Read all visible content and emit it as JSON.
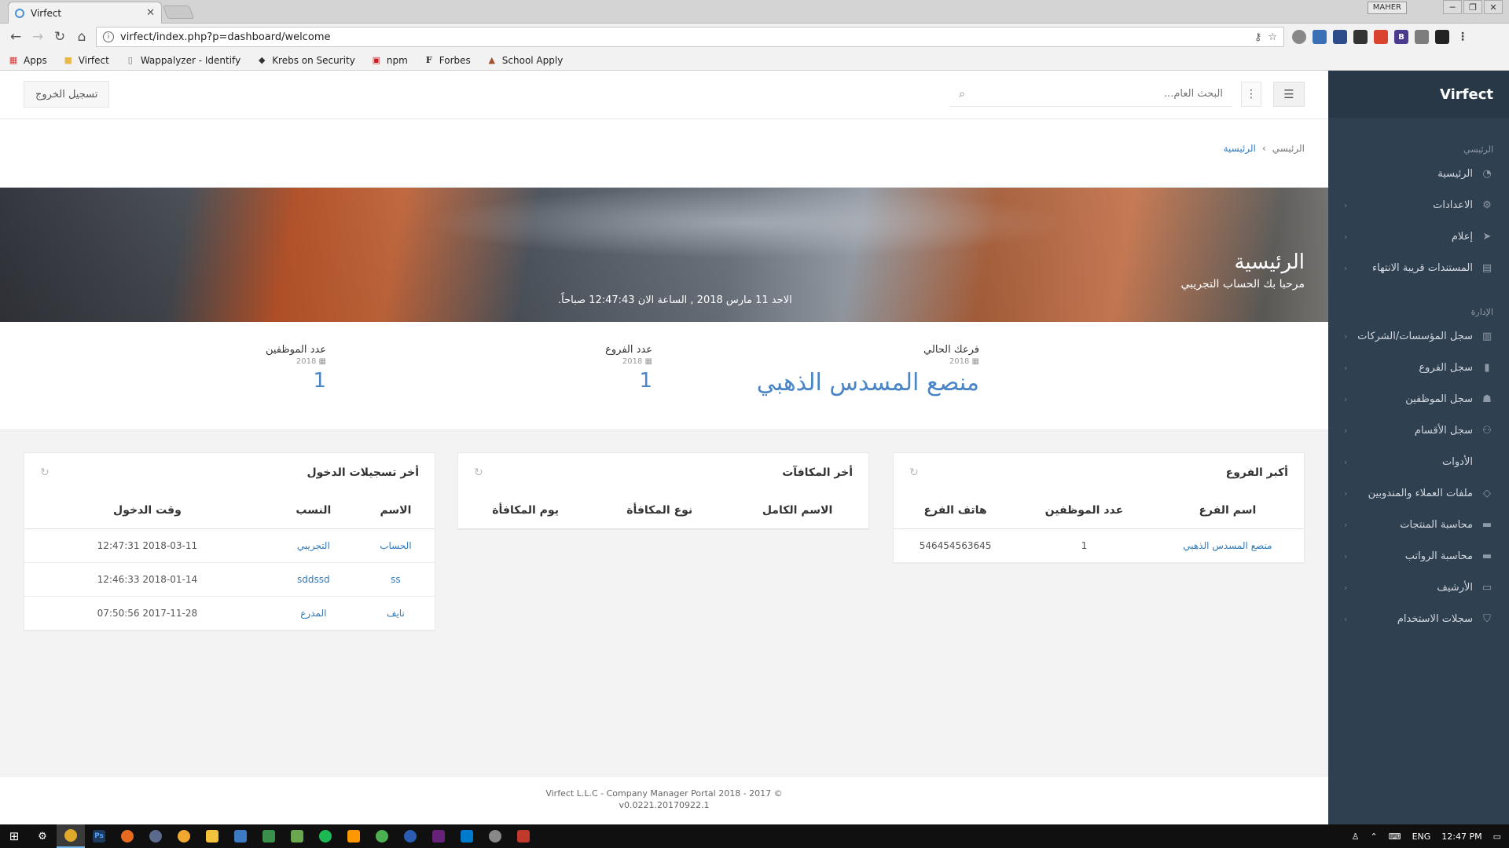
{
  "browser": {
    "tab_title": "Virfect",
    "profile_label": "MAHER",
    "url": "virfect/index.php?p=dashboard/welcome",
    "bookmarks": [
      "Apps",
      "Virfect",
      "Wappalyzer - Identify",
      "Krebs on Security",
      "npm",
      "Forbes",
      "School Apply"
    ]
  },
  "sidebar": {
    "brand": "Virfect",
    "section_main": "الرئيسي",
    "main_items": [
      {
        "label": "الرئيسية",
        "icon": "dashboard-icon"
      },
      {
        "label": "الاعدادات",
        "icon": "gear-icon"
      },
      {
        "label": "إعلام",
        "icon": "send-icon"
      },
      {
        "label": "المستندات قريبة الانتهاء",
        "icon": "file-icon"
      }
    ],
    "section_admin": "الإدارة",
    "admin_items": [
      {
        "label": "سجل المؤسسات/الشركات",
        "icon": "building-icon"
      },
      {
        "label": "سجل الفروع",
        "icon": "branch-icon"
      },
      {
        "label": "سجل الموظفين",
        "icon": "users-icon"
      },
      {
        "label": "سجل الأقسام",
        "icon": "sitemap-icon"
      },
      {
        "label": "الأدوات",
        "icon": "tools-icon"
      },
      {
        "label": "ملفات العملاء والمندوبين",
        "icon": "diamond-icon"
      },
      {
        "label": "محاسبة المنتجات",
        "icon": "calculator-icon"
      },
      {
        "label": "محاسبة الرواتب",
        "icon": "wallet-icon"
      },
      {
        "label": "الأرشيف",
        "icon": "archive-icon"
      },
      {
        "label": "سجلات الاستخدام",
        "icon": "shield-icon"
      }
    ]
  },
  "topbar": {
    "logout_label": "تسجيل الخروج",
    "search_placeholder": "البحث العام..."
  },
  "breadcrumb": {
    "home": "الرئيسي",
    "current": "الرئيسية"
  },
  "hero": {
    "title": "الرئيسية",
    "subtitle": "مرحبا بك الحساب التجريبي",
    "datetime": "الاحد 11 مارس 2018 , الساعة الان 12:47:43 صباحاً."
  },
  "stats": {
    "branch_label": "فرعك الحالي",
    "branch_year": "2018",
    "branch_value": "منصع المسدس الذهبي",
    "branches_label": "عدد الفروع",
    "branches_year": "2018",
    "branches_value": "1",
    "employees_label": "عدد الموظفين",
    "employees_year": "2018",
    "employees_value": "1"
  },
  "panels": {
    "branches": {
      "title": "أكبر الفروع",
      "columns": [
        "اسم الفرع",
        "عدد الموظفين",
        "هاتف الفرع"
      ],
      "rows": [
        [
          "منصع المسدس الذهبي",
          "1",
          "546454563645"
        ]
      ]
    },
    "rewards": {
      "title": "أخر المكافآت",
      "columns": [
        "الاسم الكامل",
        "نوع المكافأة",
        "يوم المكافأة"
      ],
      "rows": []
    },
    "logins": {
      "title": "أخر تسجيلات الدخول",
      "columns": [
        "الاسم",
        "النسب",
        "وقت الدخول"
      ],
      "rows": [
        [
          "الحساب",
          "التجريبي",
          "2018-03-11 12:47:31"
        ],
        [
          "ss",
          "sddssd",
          "2018-01-14 12:46:33"
        ],
        [
          "نايف",
          "المدرع",
          "2017-11-28 07:50:56"
        ]
      ]
    }
  },
  "footer": {
    "line1": "Virfect L.L.C - Company Manager Portal 2018 - 2017 ©",
    "line2": "v0.0221.20170922.1"
  },
  "taskbar": {
    "lang": "ENG",
    "time": "12:47 PM"
  },
  "colors": {
    "sidebar_bg": "#2f4050",
    "link": "#337ab7",
    "accent_value": "#4a86c7"
  }
}
